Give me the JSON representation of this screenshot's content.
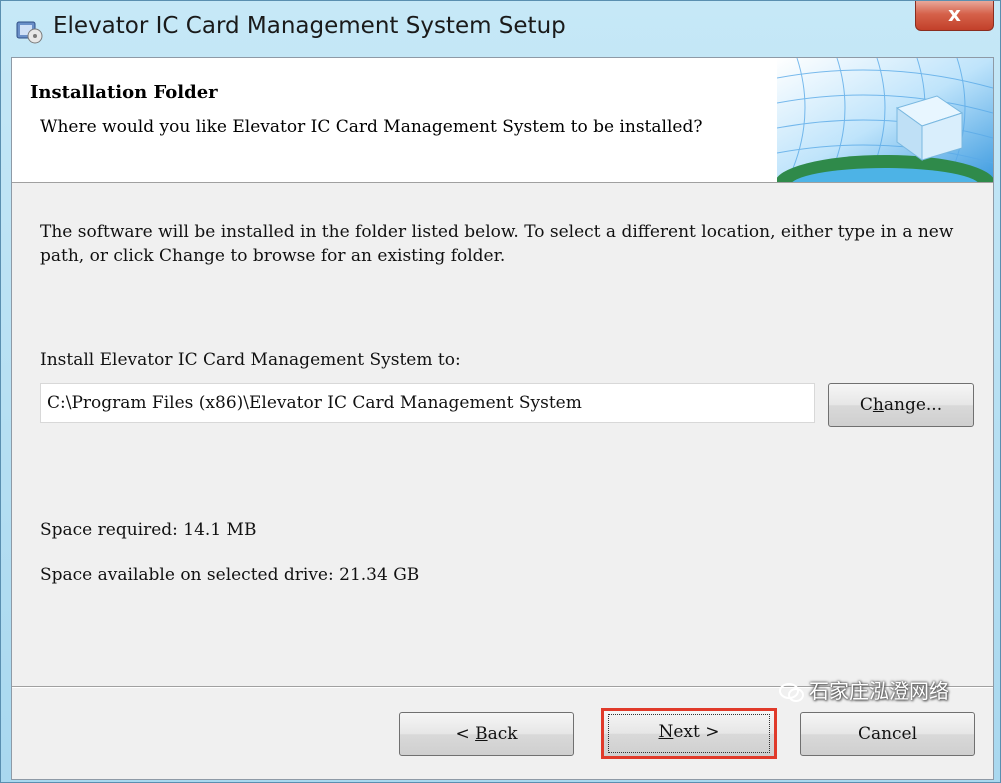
{
  "window": {
    "title": "Elevator IC Card Management System Setup",
    "close_glyph": "x"
  },
  "header": {
    "title": "Installation Folder",
    "subtitle": "Where would you like Elevator IC Card Management System to be installed?"
  },
  "body": {
    "description": "The software will be installed in the folder listed below. To select a different location, either type in a new path, or click Change to browse for an existing folder.",
    "install_label": "Install Elevator IC Card Management System to:",
    "install_path": "C:\\Program Files (x86)\\Elevator IC Card Management System",
    "change_button": {
      "prefix": "C",
      "mnemonic": "h",
      "suffix": "ange..."
    },
    "space_required": "Space required: 14.1 MB",
    "space_available": "Space available on selected drive: 21.34 GB"
  },
  "footer": {
    "back_button": {
      "prefix": "< ",
      "mnemonic": "B",
      "suffix": "ack"
    },
    "next_button": {
      "prefix": "",
      "mnemonic": "N",
      "suffix": "ext >"
    },
    "cancel_button": "Cancel"
  },
  "watermark": {
    "text": "石家庄泓澄网络",
    "icon": "wechat-icon"
  },
  "colors": {
    "highlight": "#e03a2a",
    "close_button": "#c2402a",
    "titlebar": "#bfe3f3"
  }
}
